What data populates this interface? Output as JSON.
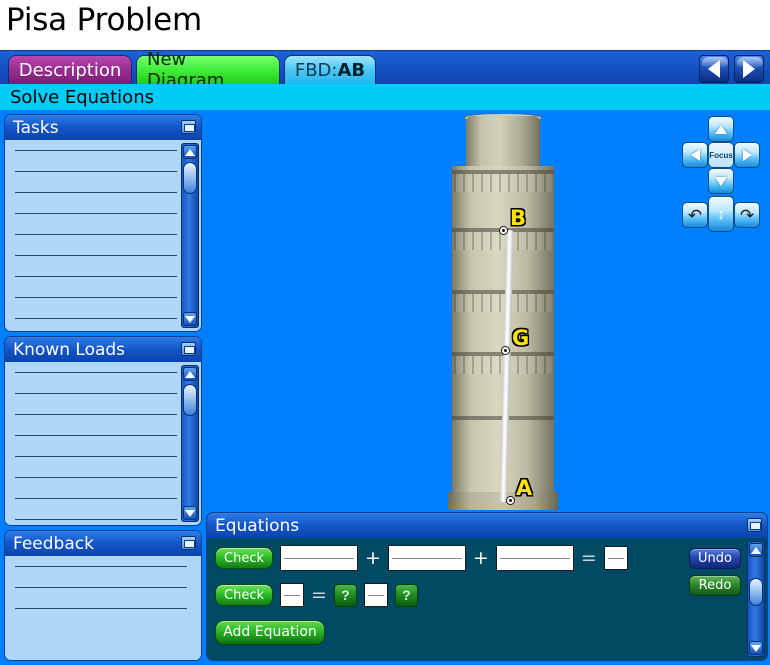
{
  "app": {
    "title": "Pisa Problem",
    "sub_header": "Solve Equations"
  },
  "tabs": [
    {
      "id": "description",
      "label": "Description",
      "color": "#9b2f93",
      "active": false
    },
    {
      "id": "new-diagram",
      "label": "New Diagram",
      "color": "#45ef3e",
      "active": false
    },
    {
      "id": "fbd",
      "label": "FBD: ",
      "label_bold": "AB",
      "color": "#4fc8f5",
      "active": true
    }
  ],
  "nav": {
    "prev_icon": "triangle-left-icon",
    "next_icon": "triangle-right-icon"
  },
  "panels": {
    "tasks": {
      "title": "Tasks",
      "line_count": 11,
      "has_scrollbar": true
    },
    "known_loads": {
      "title": "Known Loads",
      "line_count": 9,
      "has_scrollbar": true
    },
    "feedback": {
      "title": "Feedback",
      "line_count": 3,
      "has_scrollbar": false
    },
    "equations": {
      "title": "Equations"
    }
  },
  "diagram": {
    "points": [
      {
        "id": "B",
        "label": "B"
      },
      {
        "id": "G",
        "label": "G"
      },
      {
        "id": "A",
        "label": "A"
      }
    ],
    "label_color": "#ffe400",
    "canvas_color": "#0080ff"
  },
  "view_controls": {
    "focus_label": "Focus",
    "up_icon": "arrow-up-icon",
    "down_icon": "arrow-down-icon",
    "left_icon": "arrow-left-icon",
    "right_icon": "arrow-right-icon",
    "rotate_left_icon": "rotate-left-icon",
    "rotate_right_icon": "rotate-right-icon",
    "zoom_icon": "zoom-updown-icon"
  },
  "equations": {
    "check_label": "Check",
    "add_equation_label": "Add Equation",
    "undo_label": "Undo",
    "redo_label": "Redo",
    "question_label": "?",
    "rows": [
      {
        "check": "Check",
        "tokens": [
          {
            "type": "field",
            "size": "wide",
            "value": ""
          },
          {
            "type": "op",
            "value": "+"
          },
          {
            "type": "field",
            "size": "wide",
            "value": ""
          },
          {
            "type": "op",
            "value": "+"
          },
          {
            "type": "field",
            "size": "wide",
            "value": ""
          },
          {
            "type": "op",
            "value": "="
          },
          {
            "type": "field",
            "size": "small",
            "value": ""
          }
        ]
      },
      {
        "check": "Check",
        "tokens": [
          {
            "type": "field",
            "size": "small",
            "value": ""
          },
          {
            "type": "op",
            "value": "="
          },
          {
            "type": "qbtn",
            "value": "?"
          },
          {
            "type": "field",
            "size": "small",
            "value": ""
          },
          {
            "type": "qbtn",
            "value": "?"
          }
        ]
      }
    ]
  }
}
